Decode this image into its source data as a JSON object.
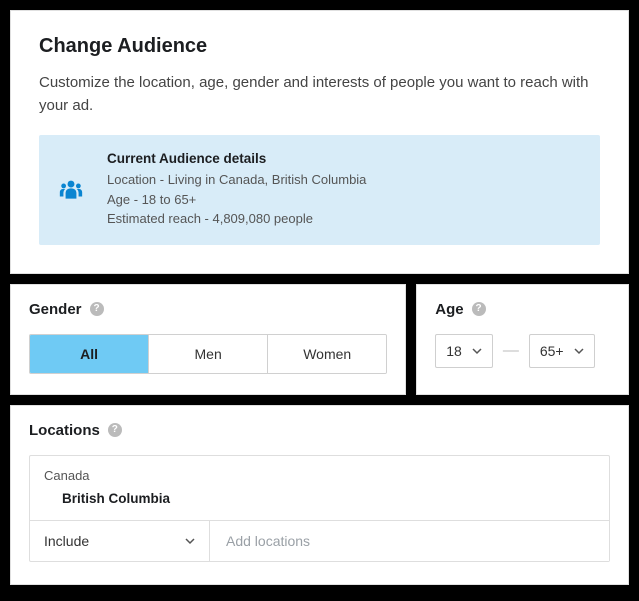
{
  "header": {
    "title": "Change Audience",
    "subtitle": "Customize the location, age, gender and interests of people you want to reach with your ad."
  },
  "audienceDetails": {
    "title": "Current Audience details",
    "location": "Location - Living in Canada, British Columbia",
    "age": "Age - 18 to 65+",
    "reach": "Estimated reach - 4,809,080 people"
  },
  "gender": {
    "label": "Gender",
    "options": {
      "all": "All",
      "men": "Men",
      "women": "Women"
    }
  },
  "age": {
    "label": "Age",
    "min": "18",
    "max": "65+"
  },
  "locations": {
    "label": "Locations",
    "country": "Canada",
    "region": "British Columbia",
    "includeLabel": "Include",
    "placeholder": "Add locations"
  }
}
